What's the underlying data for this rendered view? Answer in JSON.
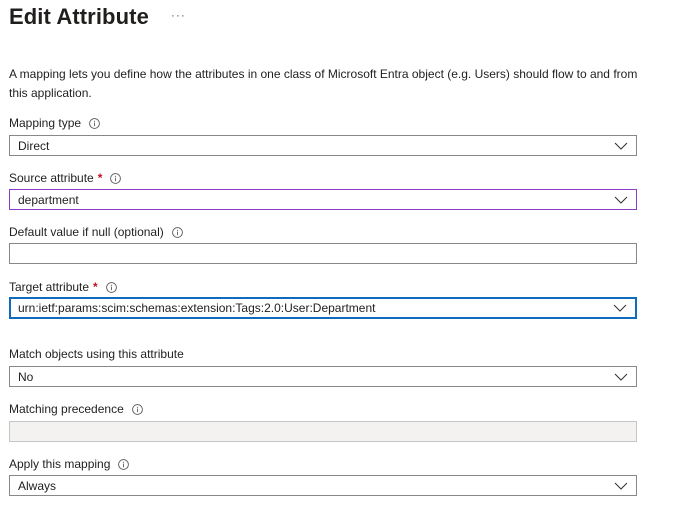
{
  "header": {
    "title": "Edit Attribute",
    "more_label": "···"
  },
  "description": "A mapping lets you define how the attributes in one class of Microsoft Entra object (e.g. Users) should flow to and from this application.",
  "fields": {
    "mapping_type": {
      "label": "Mapping type",
      "value": "Direct"
    },
    "source_attribute": {
      "label": "Source attribute",
      "required_mark": "*",
      "value": "department"
    },
    "default_value": {
      "label": "Default value if null (optional)",
      "value": ""
    },
    "target_attribute": {
      "label": "Target attribute",
      "required_mark": "*",
      "value": "urn:ietf:params:scim:schemas:extension:Tags:2.0:User:Department"
    },
    "match_objects": {
      "label": "Match objects using this attribute",
      "value": "No"
    },
    "matching_precedence": {
      "label": "Matching precedence",
      "value": ""
    },
    "apply_mapping": {
      "label": "Apply this mapping",
      "value": "Always"
    }
  },
  "icons": {
    "info": "info-icon",
    "chevron": "chevron-down-icon",
    "more": "more-icon"
  },
  "colors": {
    "required": "#c50f1f",
    "focus_purple": "#8a3ec8",
    "focus_blue": "#0f6cbd",
    "border": "#8a8886",
    "disabled_bg": "#f3f2f1"
  }
}
